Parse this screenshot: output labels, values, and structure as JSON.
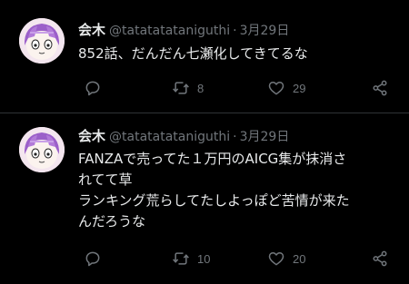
{
  "tweets": [
    {
      "name": "会木",
      "handle": "@tatatatataniguthi",
      "separator": "·",
      "date": "3月29日",
      "lines": [
        "852話、だんだん七瀬化してきてるな"
      ],
      "retweets": "8",
      "likes": "29",
      "icons": [
        "reply-icon",
        "retweet-icon",
        "like-icon",
        "share-icon"
      ]
    },
    {
      "name": "会木",
      "handle": "@tatatatataniguthi",
      "separator": "·",
      "date": "3月29日",
      "lines": [
        "FANZAで売ってた１万円のAICG集が抹消さ",
        "れてて草",
        "ランキング荒らしてたしよっぽど苦情が来た",
        "んだろうな"
      ],
      "retweets": "10",
      "likes": "20",
      "icons": [
        "reply-icon",
        "retweet-icon",
        "like-icon",
        "share-icon"
      ]
    }
  ],
  "colors": {
    "background": "#000000",
    "primary_text": "#e7e9ea",
    "secondary_text": "#71767b",
    "divider": "#2f3336",
    "avatar_hair": "#9b5fc9"
  }
}
